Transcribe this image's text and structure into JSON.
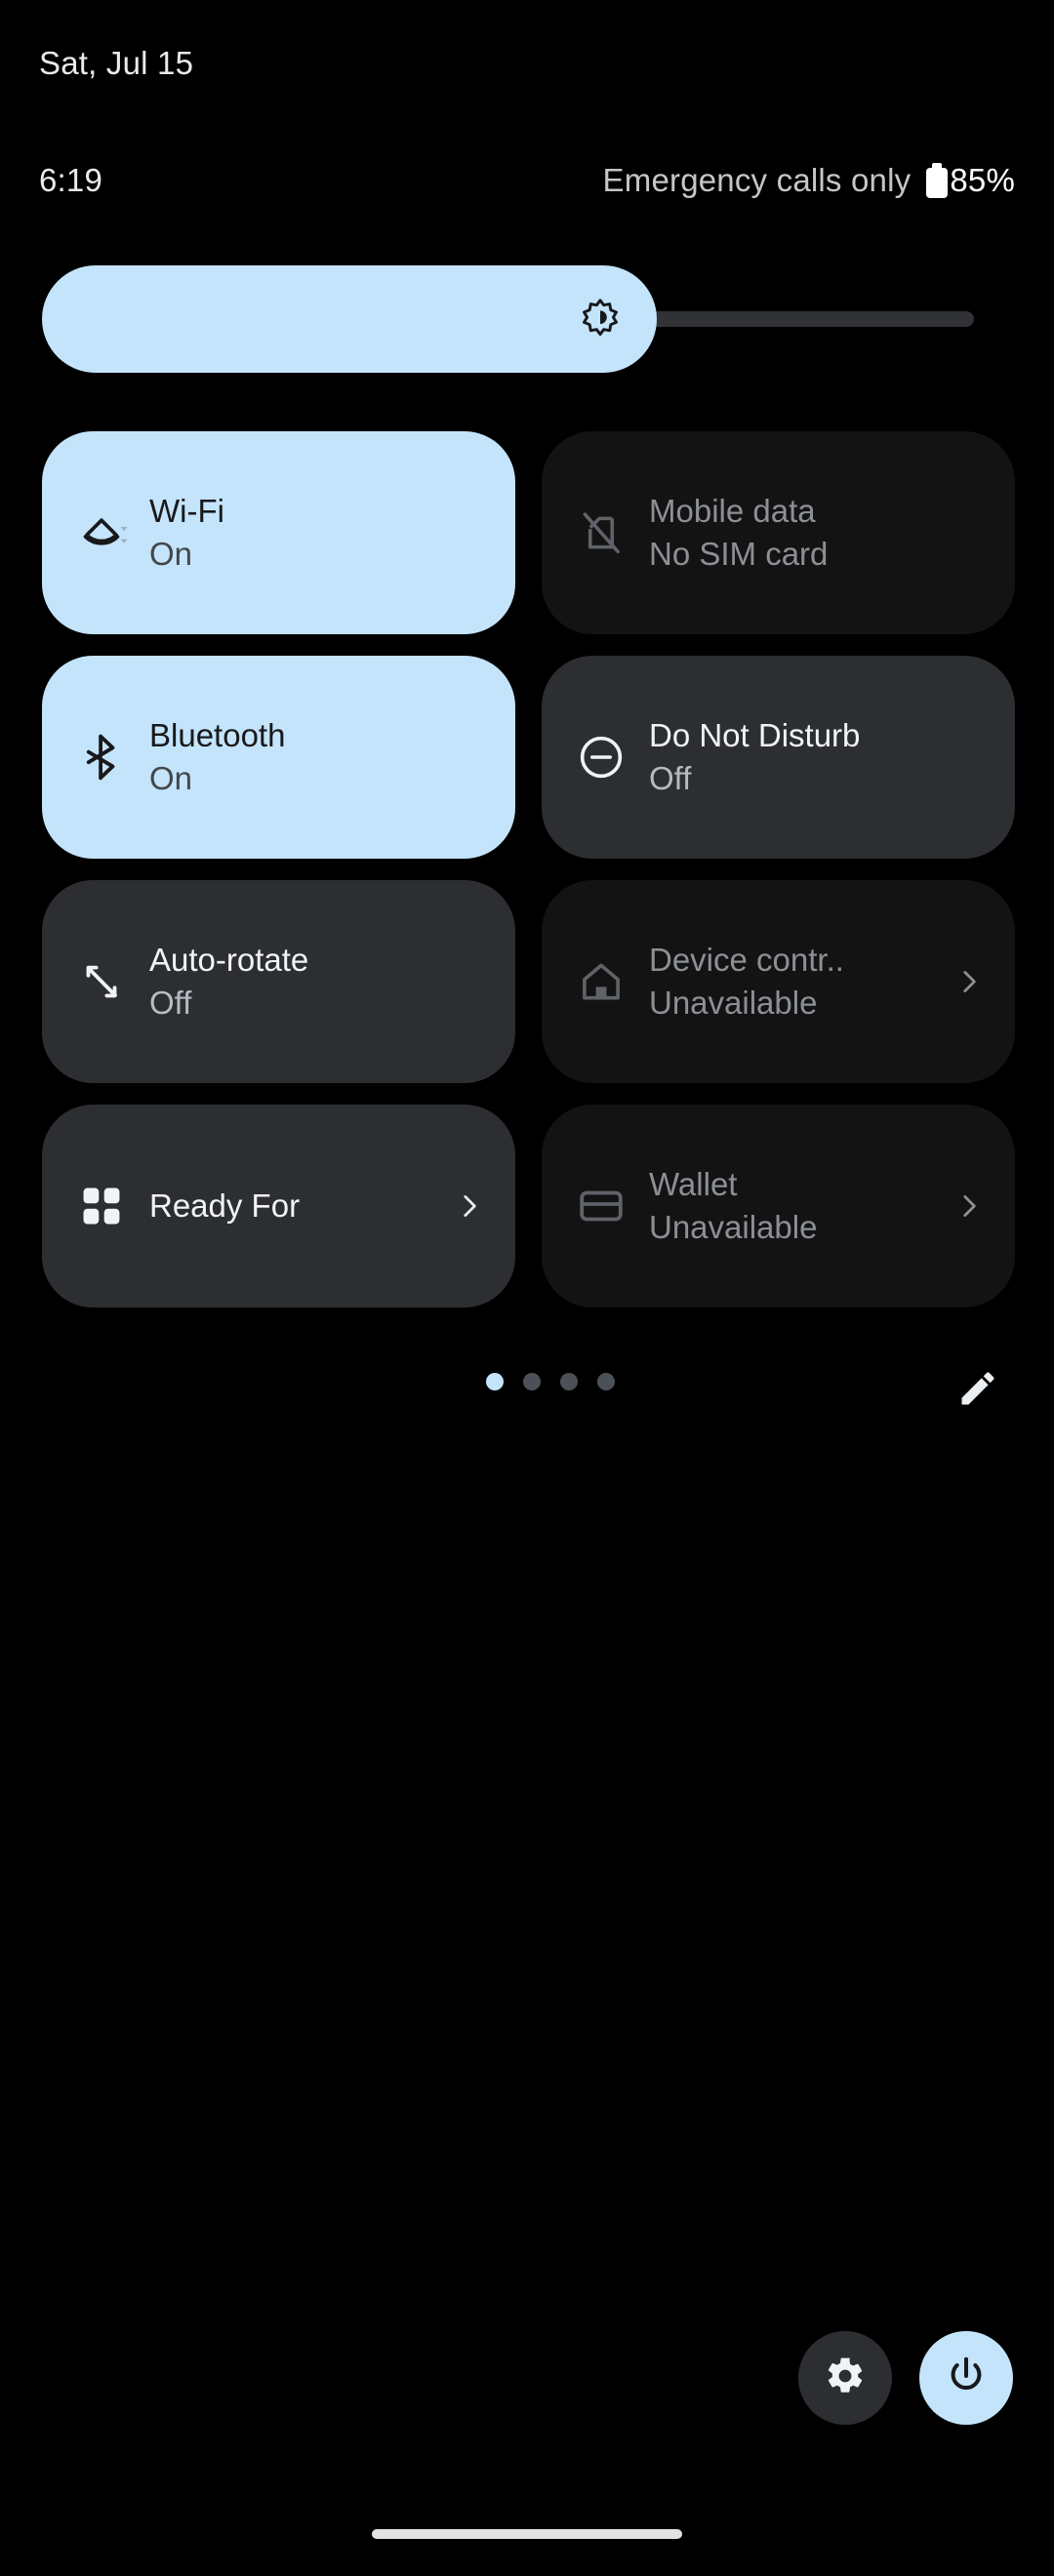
{
  "statusbar": {
    "date": "Sat, Jul 15",
    "clock": "6:19",
    "carrier": "Emergency calls only",
    "battery_percent": "85%",
    "battery_icon": "battery-icon"
  },
  "brightness": {
    "name": "brightness-slider",
    "icon": "brightness-icon",
    "level_percent": 66
  },
  "tiles": [
    {
      "name": "wifi",
      "title": "Wi-Fi",
      "subtitle": "On",
      "state": "active",
      "icon": "wifi-icon",
      "chevron": false
    },
    {
      "name": "mobile-data",
      "title": "Mobile data",
      "subtitle": "No SIM card",
      "state": "disabled",
      "icon": "sim-card-off-icon",
      "chevron": false
    },
    {
      "name": "bluetooth",
      "title": "Bluetooth",
      "subtitle": "On",
      "state": "active",
      "icon": "bluetooth-icon",
      "chevron": false
    },
    {
      "name": "do-not-disturb",
      "title": "Do Not Disturb",
      "subtitle": "Off",
      "state": "inactive",
      "icon": "do-not-disturb-icon",
      "chevron": false
    },
    {
      "name": "auto-rotate",
      "title": "Auto-rotate",
      "subtitle": "Off",
      "state": "inactive",
      "icon": "auto-rotate-icon",
      "chevron": false
    },
    {
      "name": "device-controls",
      "title": "Device contr..",
      "subtitle": "Unavailable",
      "state": "disabled",
      "icon": "home-icon",
      "chevron": true
    },
    {
      "name": "ready-for",
      "title": "Ready For",
      "subtitle": "",
      "state": "inactive",
      "icon": "grid-squares-icon",
      "chevron": true
    },
    {
      "name": "wallet",
      "title": "Wallet",
      "subtitle": "Unavailable",
      "state": "disabled",
      "icon": "credit-card-icon",
      "chevron": true
    }
  ],
  "pager": {
    "name": "page-indicator",
    "total_pages": 4,
    "current_page": 1,
    "edit_icon": "pencil-edit-icon"
  },
  "footer": {
    "settings_icon": "gear-icon",
    "power_icon": "power-icon"
  },
  "navbar": {
    "name": "gesture-home-bar"
  },
  "colors": {
    "accent_light_blue": "#c4e4fb",
    "tile_inactive": "#2c2e31",
    "tile_disabled": "#131314",
    "background": "#000000"
  }
}
